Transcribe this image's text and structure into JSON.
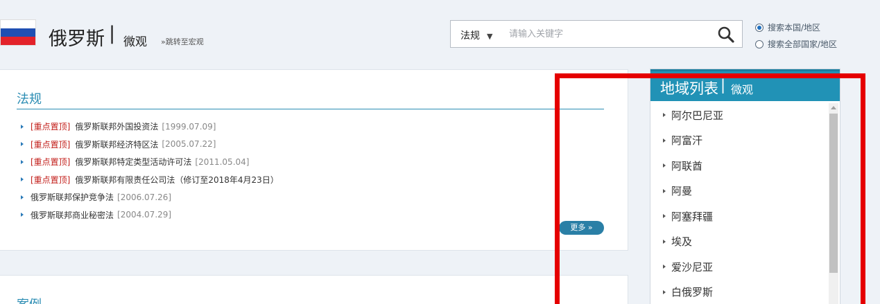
{
  "header": {
    "country": "俄罗斯",
    "separator": "|",
    "level": "微观",
    "jump_link": "»跳转至宏观"
  },
  "search": {
    "type_label": "法规",
    "type_arrow": "▼",
    "placeholder": "请输入关键字",
    "scope_options": [
      {
        "label": "搜索本国/地区",
        "selected": true
      },
      {
        "label": "搜索全部国家/地区",
        "selected": false
      }
    ]
  },
  "laws": {
    "title": "法规",
    "items": [
      {
        "tag": "[重点置顶]",
        "name": "俄罗斯联邦外国投资法",
        "date": "[1999.07.09]"
      },
      {
        "tag": "[重点置顶]",
        "name": "俄罗斯联邦经济特区法",
        "date": "[2005.07.22]"
      },
      {
        "tag": "[重点置顶]",
        "name": "俄罗斯联邦特定类型活动许可法",
        "date": "[2011.05.04]"
      },
      {
        "tag": "[重点置顶]",
        "name": "俄罗斯联邦有限责任公司法（修订至2018年4月23日）",
        "date": ""
      },
      {
        "tag": "",
        "name": "俄罗斯联邦保护竞争法",
        "date": "[2006.07.26]"
      },
      {
        "tag": "",
        "name": "俄罗斯联邦商业秘密法",
        "date": "[2004.07.29]"
      }
    ],
    "more": "更多 »"
  },
  "cases": {
    "title": "案例"
  },
  "region_list": {
    "title": "地域列表",
    "separator": "|",
    "subtitle": "微观",
    "items": [
      "阿尔巴尼亚",
      "阿富汗",
      "阿联酋",
      "阿曼",
      "阿塞拜疆",
      "埃及",
      "爱沙尼亚",
      "白俄罗斯"
    ]
  },
  "colors": {
    "accent": "#2a8cb3",
    "region_header": "#2192b6",
    "tag_red": "#c3201c",
    "annotation": "#e50000"
  }
}
